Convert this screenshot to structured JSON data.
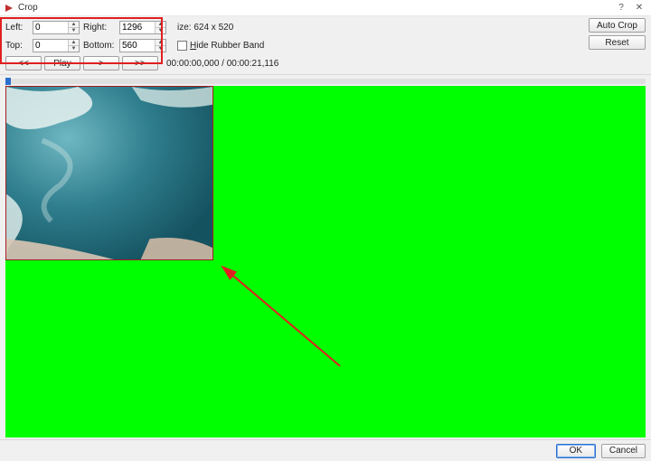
{
  "title": "Crop",
  "controls": {
    "left_label": "Left:",
    "left_value": "0",
    "right_label": "Right:",
    "right_value": "1296",
    "top_label": "Top:",
    "top_value": "0",
    "bottom_label": "Bottom:",
    "bottom_value": "560",
    "size_label": "ize:",
    "size_value": "624 x 520",
    "hide_rubber_band": "ide Rubber Band"
  },
  "play": {
    "rewind": "<<",
    "play": "Play",
    "step": ">",
    "ffwd": ">>",
    "time": "00:00:00,000 / 00:00:21,116"
  },
  "right_buttons": {
    "auto_crop": "Auto Crop",
    "reset": "Reset"
  },
  "footer": {
    "ok": "OK",
    "cancel": "Cancel"
  },
  "colors": {
    "highlight": "#e02020",
    "canvas_bg": "#00ff00",
    "accent": "#2a6fcd"
  }
}
